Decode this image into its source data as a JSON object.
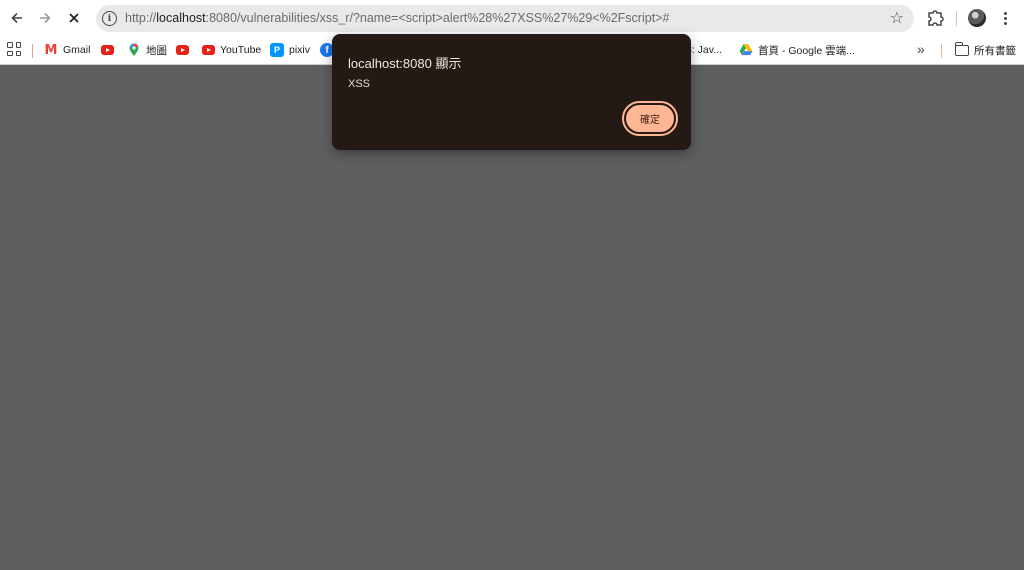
{
  "browser": {
    "url_prefix": "http://",
    "url_host": "localhost",
    "url_rest": ":8080/vulnerabilities/xss_r/?name=<script>alert%28%27XSS%27%29<%2Fscript>#",
    "back_icon": "arrow-left-icon",
    "forward_icon": "arrow-right-icon",
    "stop_icon": "close-icon",
    "site_info_icon": "info-icon",
    "bookmark_star_icon": "star-icon",
    "extensions_icon": "puzzle-icon",
    "menu_icon": "kebab-menu-icon"
  },
  "bookmarks": {
    "items": [
      {
        "label": "Gmail",
        "icon": "gmail-icon"
      },
      {
        "label": "",
        "icon": "youtube-icon"
      },
      {
        "label": "地圖",
        "icon": "maps-pin-icon"
      },
      {
        "label": "",
        "icon": "youtube-icon"
      },
      {
        "label": "YouTube",
        "icon": "youtube-icon"
      },
      {
        "label": "pixiv",
        "icon": "pixiv-icon"
      },
      {
        "label": "",
        "icon": "facebook-icon"
      },
      {
        "label": "8: Jav...",
        "icon": ""
      },
      {
        "label": "首頁 - Google 雲端...",
        "icon": "google-drive-icon"
      }
    ],
    "overflow": "»",
    "all_bookmarks": "所有書籤"
  },
  "dialog": {
    "title": "localhost:8080 顯示",
    "message": "XSS",
    "ok_label": "確定"
  },
  "colors": {
    "page_overlay": "#5f5f5f",
    "dialog_bg": "#231915",
    "ok_button": "#ffb694"
  }
}
